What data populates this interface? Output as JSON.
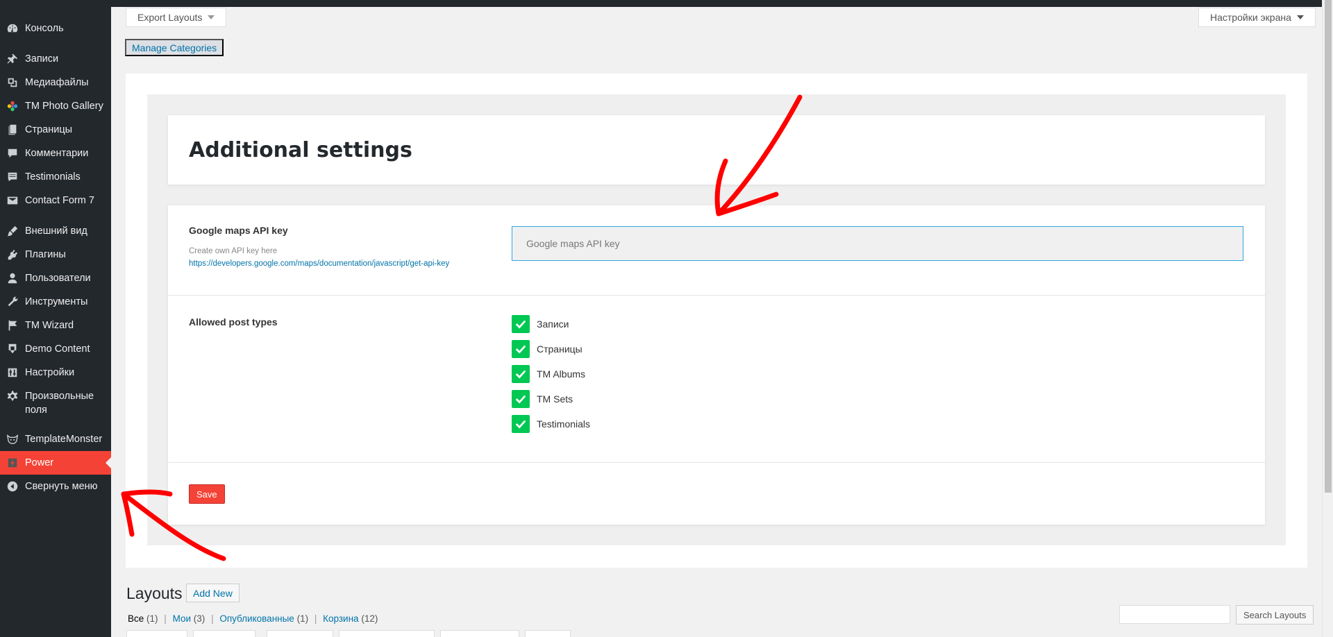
{
  "sidebar": {
    "items": [
      {
        "label": "Консоль",
        "icon": "dashboard-icon"
      },
      {
        "label": "Записи",
        "icon": "pushpin-icon"
      },
      {
        "label": "Медиафайлы",
        "icon": "media-icon"
      },
      {
        "label": "TM Photo Gallery",
        "icon": "flower-icon"
      },
      {
        "label": "Страницы",
        "icon": "pages-icon"
      },
      {
        "label": "Комментарии",
        "icon": "comment-icon"
      },
      {
        "label": "Testimonials",
        "icon": "testimonials-icon"
      },
      {
        "label": "Contact Form 7",
        "icon": "envelope-icon"
      },
      {
        "label": "Внешний вид",
        "icon": "paintbrush-icon"
      },
      {
        "label": "Плагины",
        "icon": "plugin-icon"
      },
      {
        "label": "Пользователи",
        "icon": "user-icon"
      },
      {
        "label": "Инструменты",
        "icon": "wrench-icon"
      },
      {
        "label": "TM Wizard",
        "icon": "flag-icon"
      },
      {
        "label": "Demo Content",
        "icon": "download-icon"
      },
      {
        "label": "Настройки",
        "icon": "settings-icon"
      },
      {
        "label": "Произвольные поля",
        "icon": "gear-icon"
      },
      {
        "label": "TemplateMonster",
        "icon": "templatemonster-icon"
      },
      {
        "label": "Power",
        "icon": "power-icon",
        "active": true
      },
      {
        "label": "Свернуть меню",
        "icon": "collapse-icon"
      }
    ]
  },
  "toolbar": {
    "export_label": "Export Layouts",
    "screen_options_label": "Настройки экрана",
    "categories_label": "Manage Categories"
  },
  "settings": {
    "title": "Additional settings",
    "api_key": {
      "label": "Google maps API key",
      "desc": "Create own API key here",
      "link": "https://developers.google.com/maps/documentation/javascript/get-api-key",
      "placeholder": "Google maps API key",
      "value": ""
    },
    "post_types": {
      "label": "Allowed post types",
      "items": [
        "Записи",
        "Страницы",
        "TM Albums",
        "TM Sets",
        "Testimonials"
      ]
    },
    "save_label": "Save"
  },
  "layouts": {
    "title": "Layouts",
    "add_new_label": "Add New",
    "filters": {
      "all": "Все",
      "all_count": "(1)",
      "mine": "Мои",
      "mine_count": "(3)",
      "published": "Опубликованные",
      "published_count": "(1)",
      "trash": "Корзина",
      "trash_count": "(12)"
    },
    "search_label": "Search Layouts"
  },
  "colors": {
    "sidebar_bg": "#23282d",
    "active_menu": "#f44336",
    "check_green": "#00c853",
    "link_blue": "#0073aa",
    "annotation_red": "#ff0000"
  }
}
